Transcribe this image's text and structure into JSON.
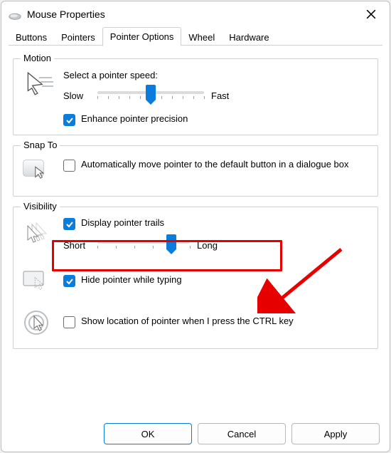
{
  "window": {
    "title": "Mouse Properties"
  },
  "tabs": {
    "items": [
      {
        "label": "Buttons",
        "active": false
      },
      {
        "label": "Pointers",
        "active": false
      },
      {
        "label": "Pointer Options",
        "active": true
      },
      {
        "label": "Wheel",
        "active": false
      },
      {
        "label": "Hardware",
        "active": false
      }
    ]
  },
  "motion": {
    "title": "Motion",
    "speed_label": "Select a pointer speed:",
    "slow": "Slow",
    "fast": "Fast",
    "speed_value": 5,
    "speed_ticks": 11,
    "enhance_label": "Enhance pointer precision",
    "enhance_checked": true
  },
  "snap": {
    "title": "Snap To",
    "auto_label": "Automatically move pointer to the default button in a dialogue box",
    "auto_checked": false
  },
  "visibility": {
    "title": "Visibility",
    "trails_label": "Display pointer trails",
    "trails_checked": true,
    "short_label": "Short",
    "long_label": "Long",
    "trails_value": 4,
    "trails_ticks": 6,
    "hide_label": "Hide pointer while typing",
    "hide_checked": true,
    "ctrl_label": "Show location of pointer when I press the CTRL key",
    "ctrl_checked": false
  },
  "buttons": {
    "ok": "OK",
    "cancel": "Cancel",
    "apply": "Apply"
  }
}
